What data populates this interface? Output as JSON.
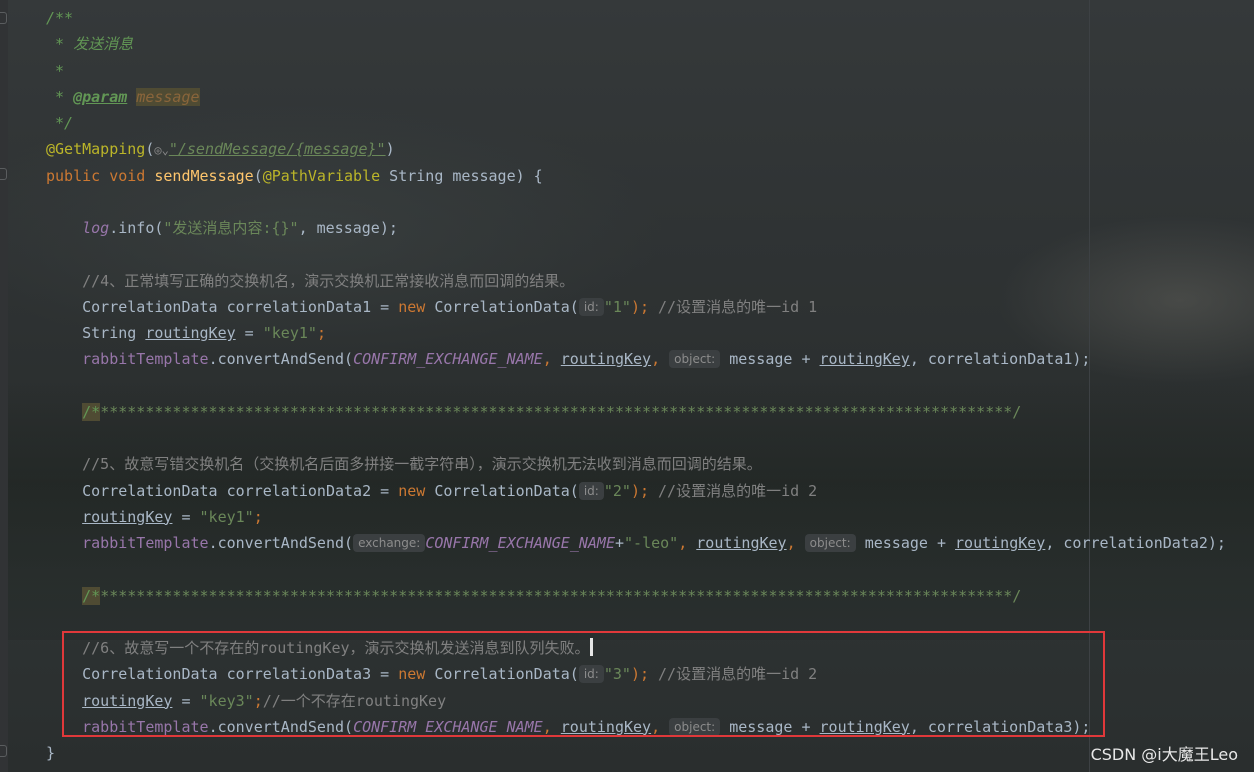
{
  "editor": {
    "doc_open": "/**",
    "doc_title": " * 发送消息",
    "doc_blank": " *",
    "doc_star": " * ",
    "doc_param_tag": "@param",
    "doc_param_name": "message",
    "doc_close": " */",
    "annotation_get": "@GetMapping",
    "get_path": "\"/sendMessage/{message}\"",
    "kw_public": "public",
    "kw_void": "void",
    "method_name": "sendMessage",
    "annotation_path": "@PathVariable",
    "param_decl": " String message) {",
    "log_obj": "log",
    "log_call": ".info(",
    "log_str": "\"发送消息内容:{}\"",
    "log_rest": ", message);",
    "comment4": "//4、正常填写正确的交换机名，演示交换机正常接收消息而回调的结果。",
    "type_corr": "CorrelationData",
    "var_corr1": " correlationData1 = ",
    "kw_new": "new",
    "ctor": " CorrelationData(",
    "hint_id": "id:",
    "str_1": "\"1\"",
    "comment_id1": "//设置消息的唯一id 1",
    "type_string": "String",
    "var_routing": "routingKey",
    "str_key1": "\"key1\"",
    "rabbit": "rabbitTemplate",
    "send_call": ".convertAndSend(",
    "const_exchange": "CONFIRM_EXCHANGE_NAME",
    "hint_object": "object:",
    "hint_exchange": "exchange:",
    "msg_plus": " message + ",
    "arg_corr1": ", correlationData1);",
    "separator_start": "/*",
    "separator_rest": "*****************************************************************************************************/",
    "comment5": "//5、故意写错交换机名（交换机名后面多拼接一截字符串），演示交换机无法收到消息而回调的结果。",
    "var_corr2": " correlationData2 = ",
    "str_2": "\"2\"",
    "comment_id2": "//设置消息的唯一id 2",
    "str_leo": "\"-leo\"",
    "arg_corr2": ", correlationData2);",
    "comment6": "//6、故意写一个不存在的routingKey，演示交换机发送消息到队列失败。",
    "var_corr3": " correlationData3 = ",
    "str_3": "\"3\"",
    "str_key3": "\"key3\"",
    "comment_key3": "//一个不存在routingKey",
    "arg_corr3": ", correlationData3);",
    "close_brace": "}"
  },
  "watermark": "CSDN @i大魔王Leo",
  "colors": {
    "highlight_box": "#e0383a",
    "keyword": "#cc7832",
    "string": "#6a8759",
    "method": "#ffc66d",
    "constant": "#9876aa"
  }
}
